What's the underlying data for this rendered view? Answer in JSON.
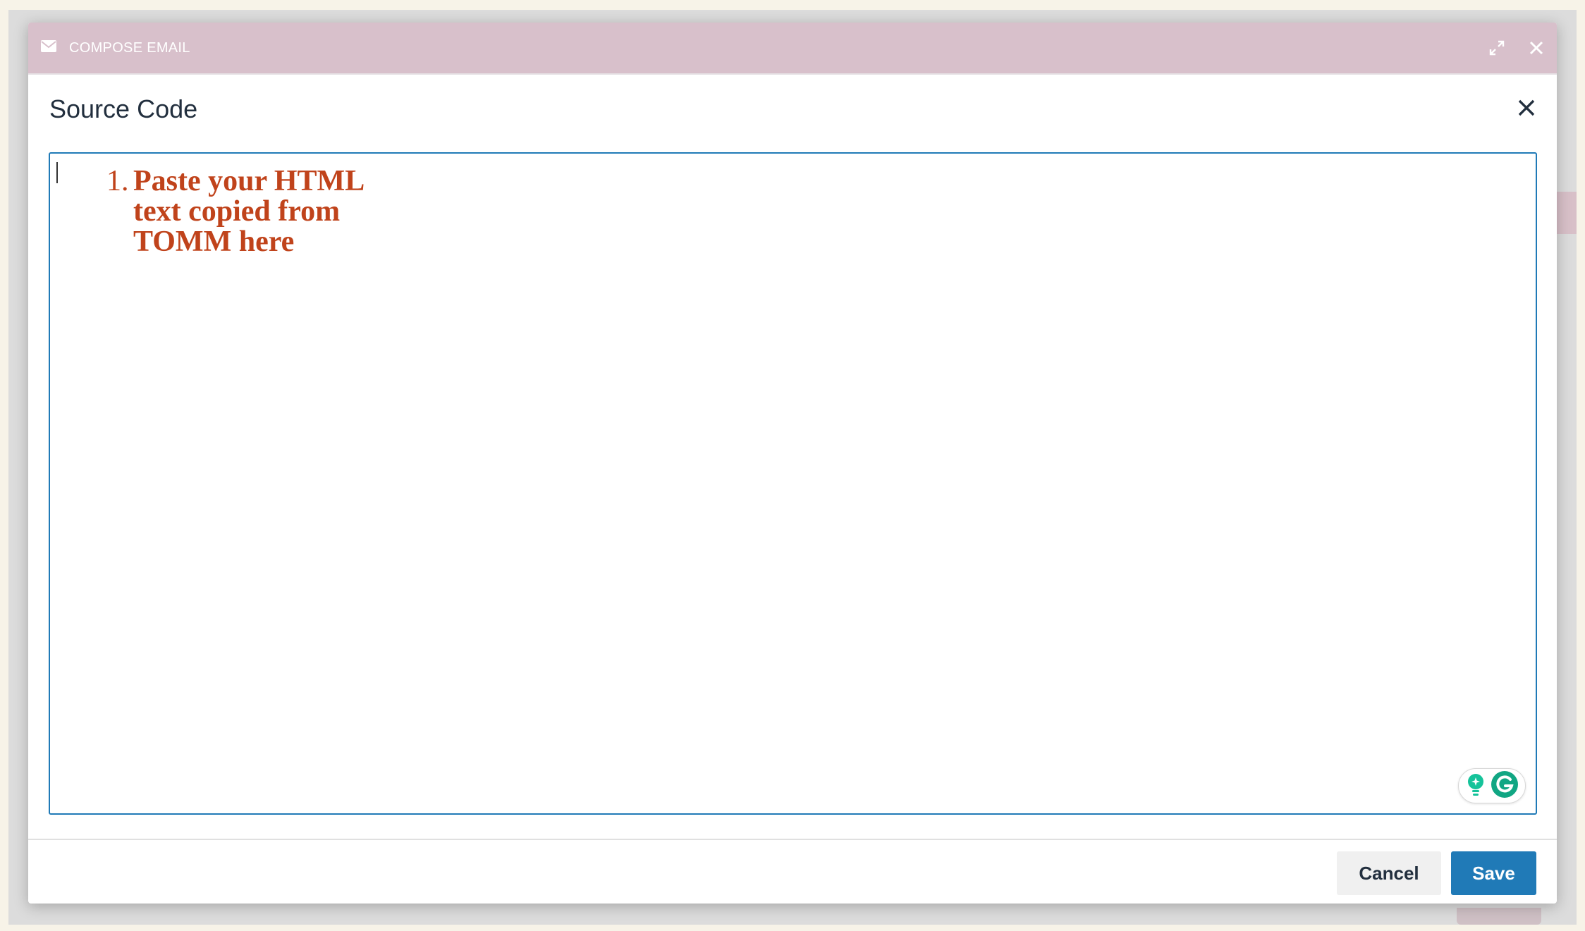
{
  "compose": {
    "title": "COMPOSE EMAIL",
    "icons": {
      "mail": "envelope-icon",
      "expand": "expand-icon",
      "close": "close-icon"
    }
  },
  "dialog": {
    "title": "Source Code",
    "close_icon": "close-icon"
  },
  "editor": {
    "items": [
      {
        "number": "1.",
        "text": "Paste your HTML text copied from TOMM here"
      }
    ],
    "text_color": "#c0431b",
    "border_color": "#207ab7"
  },
  "footer": {
    "cancel_label": "Cancel",
    "save_label": "Save"
  },
  "colors": {
    "header_bg": "#d8c0cb",
    "primary": "#207ab7",
    "grammarly": "#15c39a"
  }
}
